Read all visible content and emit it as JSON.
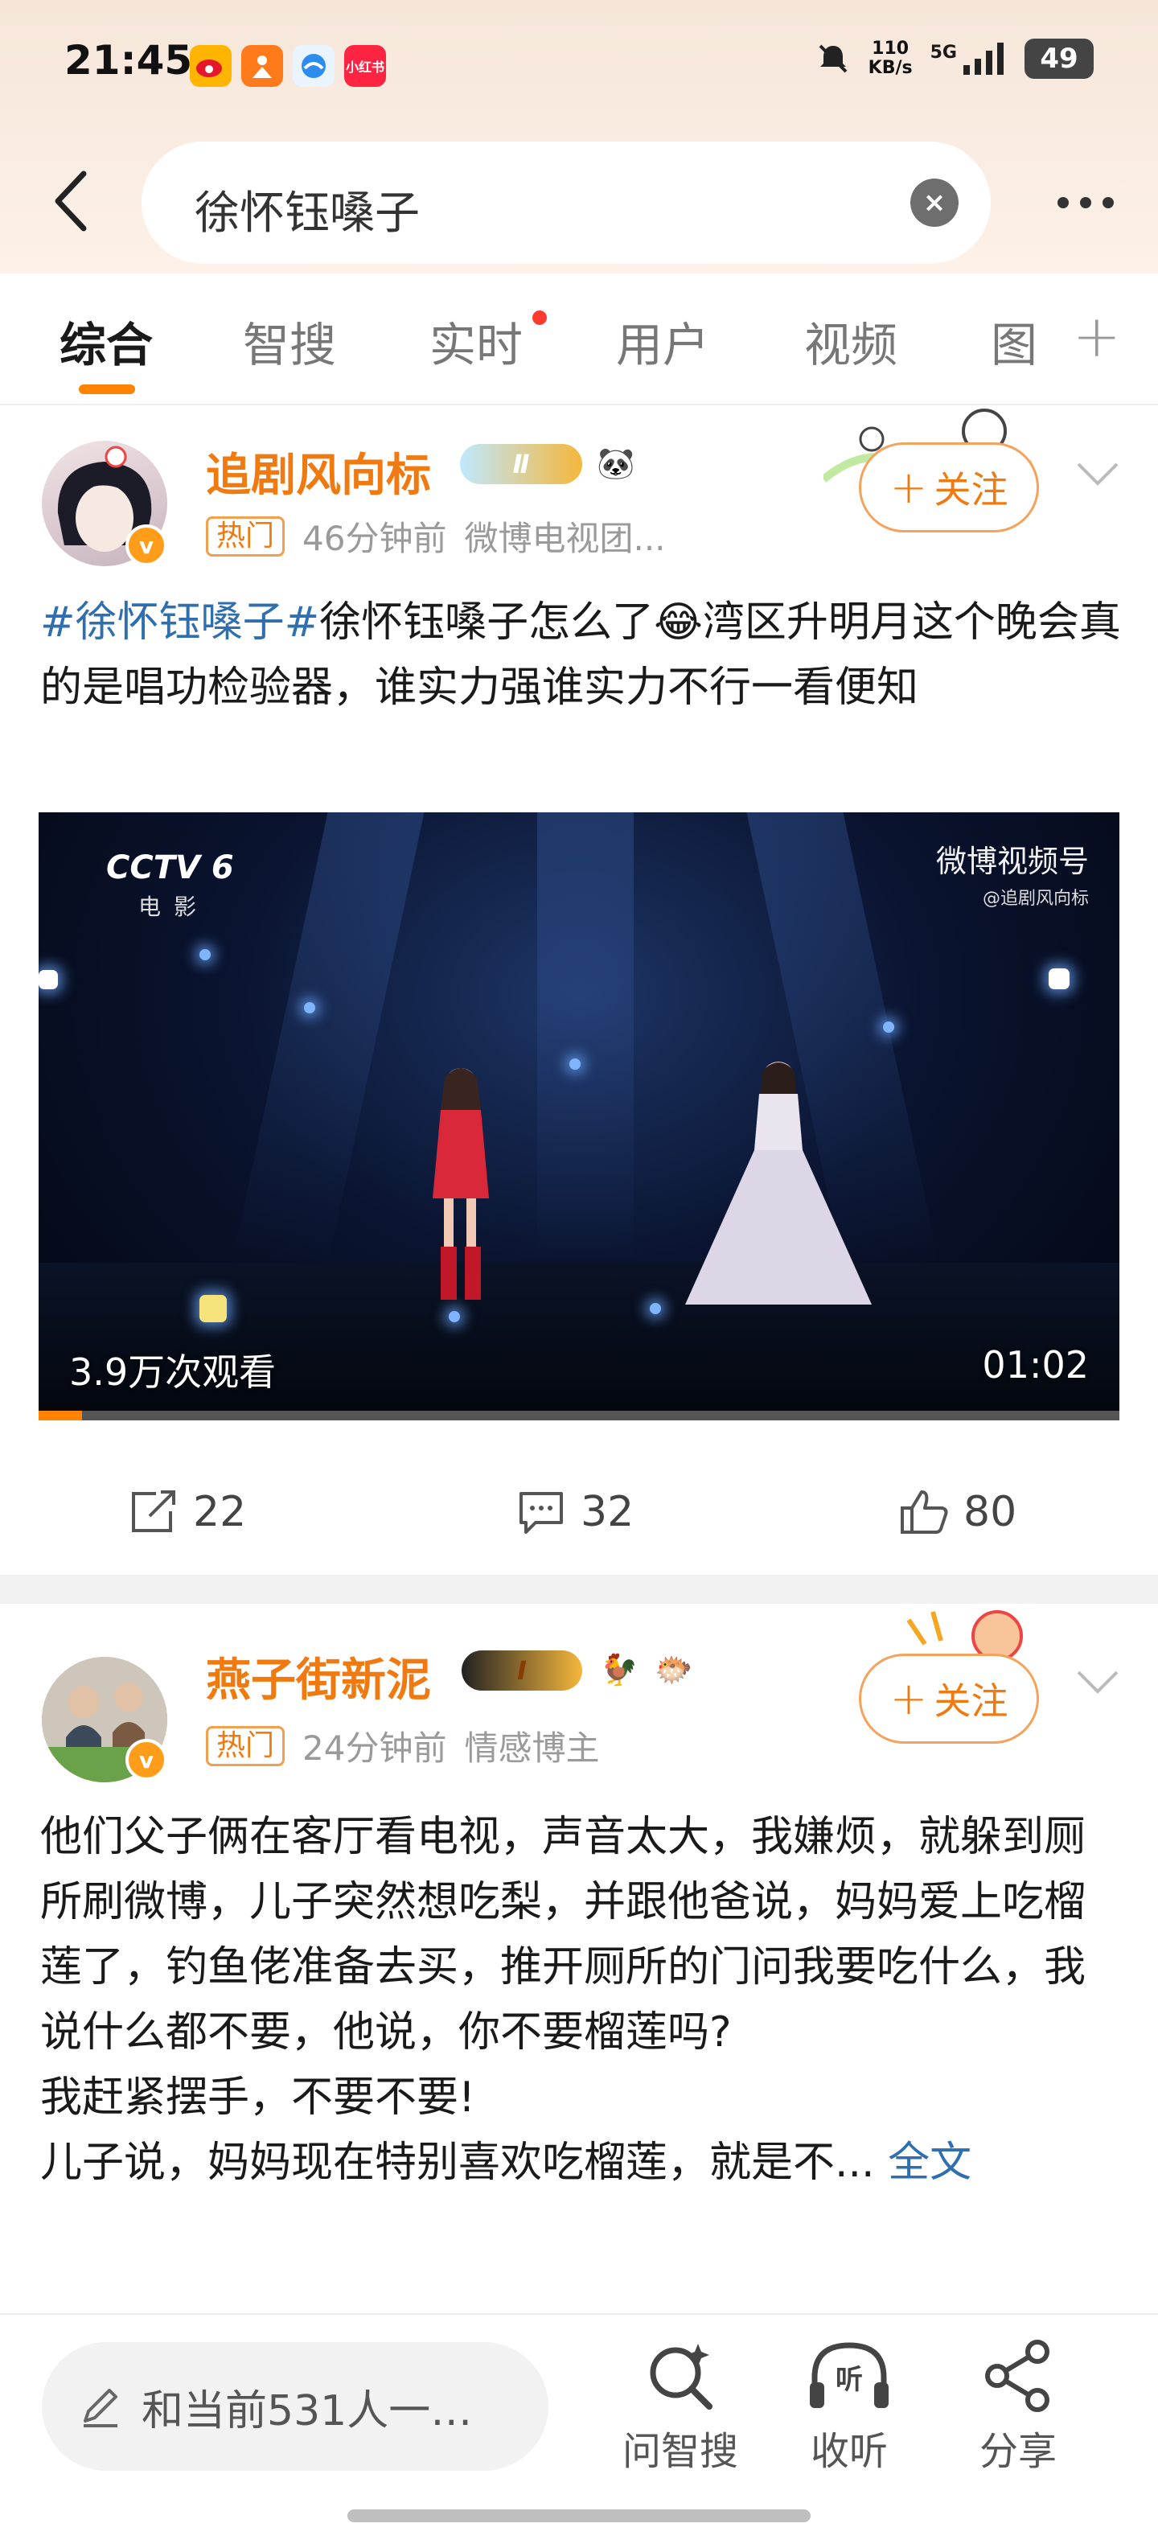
{
  "status_bar": {
    "time": "21:45",
    "net_speed_value": "110",
    "net_speed_unit": "KB/s",
    "network": "5G",
    "battery": "49",
    "app_badge_label": "小红书"
  },
  "search": {
    "query": "徐怀钰嗓子"
  },
  "tabs": [
    "综合",
    "智搜",
    "实时",
    "用户",
    "视频",
    "图"
  ],
  "posts": [
    {
      "username": "追剧风向标",
      "level": "Ⅱ",
      "hot_tag": "热门",
      "time": "46分钟前",
      "source": "微博电视团...",
      "follow_label": "关注",
      "hashtag": "#徐怀钰嗓子#",
      "text": "徐怀钰嗓子怎么了😂湾区升明月这个晚会真的是唱功检验器，谁实力强谁实力不行一看便知",
      "video": {
        "channel": "CCTV 6",
        "channel_sub": "电影",
        "watermark": "微博视频号",
        "watermark_sub": "@追剧风向标",
        "views": "3.9万次观看",
        "duration": "01:02",
        "progress": 0.04
      },
      "reposts": "22",
      "comments": "32",
      "likes": "80"
    },
    {
      "username": "燕子街新泥",
      "level": "I",
      "hot_tag": "热门",
      "time": "24分钟前",
      "source": "情感博主",
      "follow_label": "关注",
      "text_lines": [
        "他们父子俩在客厅看电视，声音太大，我嫌烦，就躲到厕所刷微博，儿子突然想吃梨，并跟他爸说，妈妈爱上吃榴莲了，钓鱼佬准备去买，推开厕所的门问我要吃什么，我说什么都不要，他说，你不要榴莲吗?",
        "我赶紧摆手，不要不要!",
        "儿子说，妈妈现在特别喜欢吃榴莲，就是不..."
      ],
      "more_label": "全文"
    }
  ],
  "bottom_bar": {
    "join_text": "和当前531人一…",
    "ask_label": "问智搜",
    "listen_label": "收听",
    "share_label": "分享"
  },
  "colors": {
    "accent": "#ff8200",
    "username": "#f07a10",
    "link": "#2f6fb0"
  }
}
